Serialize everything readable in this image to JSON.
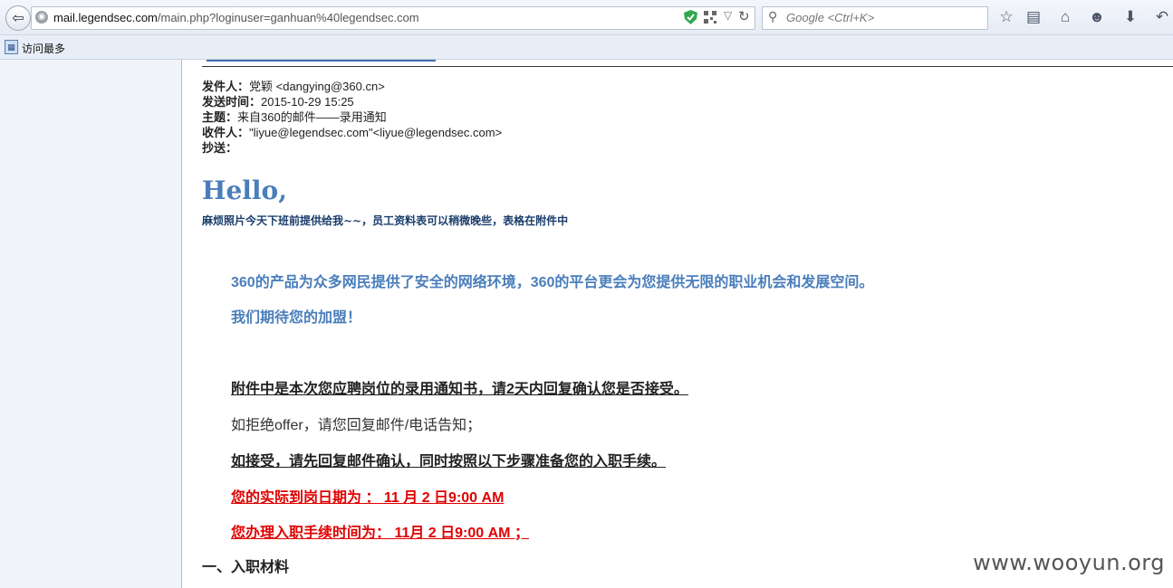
{
  "browser": {
    "url_host": "mail.legendsec.com",
    "url_path": "/main.php?loginuser=ganhuan%40legendsec.com",
    "search_placeholder": "Google <Ctrl+K>",
    "bookmark_label": "访问最多"
  },
  "email": {
    "from_label": "发件人：",
    "from_value": "党颖 <dangying@360.cn>",
    "date_label": "发送时间：",
    "date_value": "2015-10-29 15:25",
    "subject_label": "主题：",
    "subject_value": "来自360的邮件——录用通知",
    "to_label": "收件人：",
    "to_value": "\"liyue@legendsec.com\"<liyue@legendsec.com>",
    "cc_label": "抄送："
  },
  "body": {
    "greeting": "Hello,",
    "note": "麻烦照片今天下班前提供给我~~，员工资料表可以稍微晚些，表格在附件中",
    "line1": "360的产品为众多网民提供了安全的网络环境，360的平台更会为您提供无限的职业机会和发展空间。",
    "line2": "我们期待您的加盟！",
    "line3": "附件中是本次您应聘岗位的录用通知书，请2天内回复确认您是否接受。",
    "line4": "如拒绝offer，请您回复邮件/电话告知；",
    "line5": "如接受，请先回复邮件确认，同时按照以下步骤准备您的入职手续。",
    "line6": "您的实际到岗日期为 ：   11 月 2 日9:00 AM",
    "line7": "您办理入职手续时间为：  11月 2 日9:00 AM ；",
    "section1": "一、入职材料"
  },
  "watermark": "www.wooyun.org"
}
